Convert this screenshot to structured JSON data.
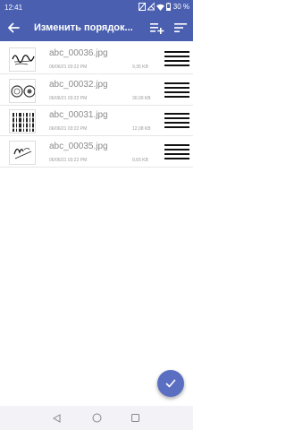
{
  "status_bar": {
    "time": "12:41",
    "battery": "30 %"
  },
  "app_bar": {
    "title": "Изменить порядок..."
  },
  "files": [
    {
      "name": "abc_00036.jpg",
      "date": "06/06/21 03:22 PM",
      "size": "9,35 KB"
    },
    {
      "name": "abc_00032.jpg",
      "date": "06/06/21 03:22 PM",
      "size": "30,09 KB"
    },
    {
      "name": "abc_00031.jpg",
      "date": "06/06/21 03:22 PM",
      "size": "12,08 KB"
    },
    {
      "name": "abc_00035.jpg",
      "date": "06/06/21 03:22 PM",
      "size": "9,65 KB"
    }
  ],
  "icons": {
    "back": "arrow-left-icon",
    "add_list": "playlist-add-icon",
    "sort": "sort-icon",
    "drag": "drag-handle-icon",
    "fab": "check-icon"
  },
  "colors": {
    "primary": "#4a5fb0",
    "fab": "#5a6fc2"
  }
}
